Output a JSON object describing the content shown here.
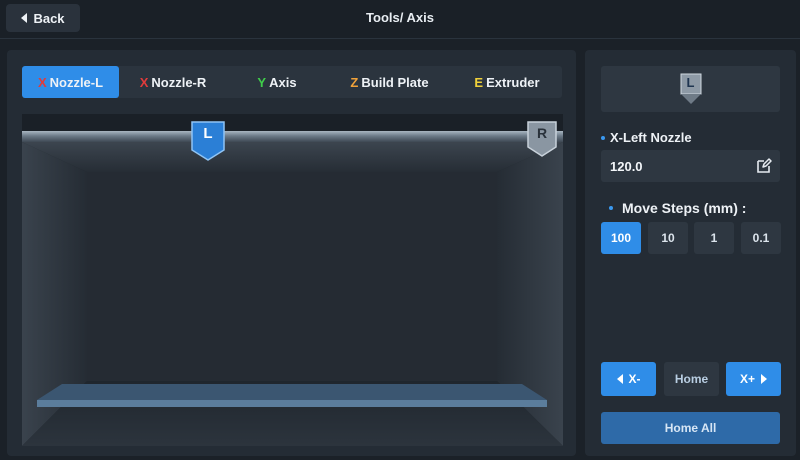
{
  "header": {
    "back_label": "Back",
    "title": "Tools/ Axis"
  },
  "tabs": [
    {
      "axis": "X",
      "label": "Nozzle-L",
      "axis_color": "#e23b3b",
      "active": true
    },
    {
      "axis": "X",
      "label": "Nozzle-R",
      "axis_color": "#e23b3b",
      "active": false
    },
    {
      "axis": "Y",
      "label": "Axis",
      "axis_color": "#3fce4a",
      "active": false
    },
    {
      "axis": "Z",
      "label": "Build Plate",
      "axis_color": "#f0a23a",
      "active": false
    },
    {
      "axis": "E",
      "label": "Extruder",
      "axis_color": "#f0d13a",
      "active": false
    }
  ],
  "visualization": {
    "left_nozzle_letter": "L",
    "right_nozzle_letter": "R"
  },
  "panel": {
    "nozzle_icon_letter": "L",
    "position_label": "X-Left Nozzle",
    "position_value": "120.0",
    "steps_label": "Move Steps (mm) :",
    "steps": [
      "100",
      "10",
      "1",
      "0.1"
    ],
    "selected_step": "100",
    "x_minus_label": "X-",
    "home_label": "Home",
    "x_plus_label": "X+",
    "home_all_label": "Home All"
  },
  "colors": {
    "accent": "#2f8de8",
    "background": "#1b2128",
    "panel": "#242c35"
  }
}
